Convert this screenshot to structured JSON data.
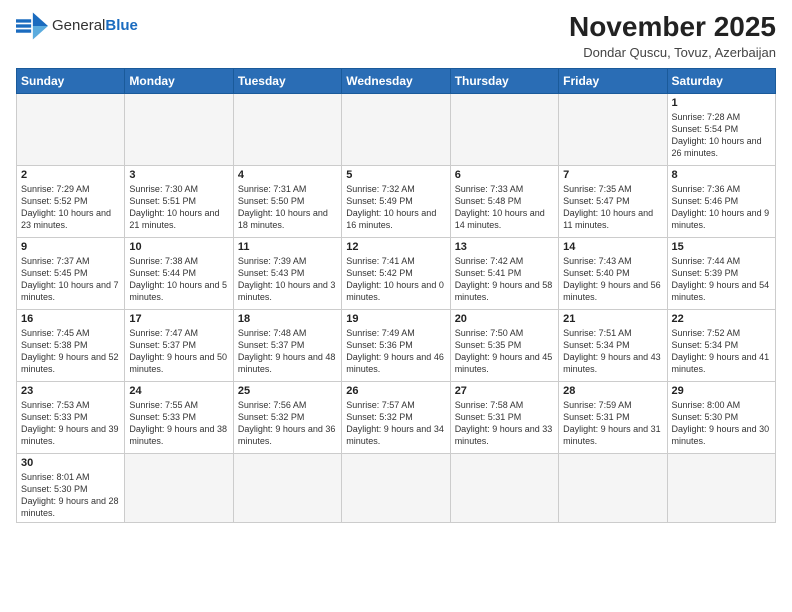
{
  "header": {
    "logo_general": "General",
    "logo_blue": "Blue",
    "month_year": "November 2025",
    "location": "Dondar Quscu, Tovuz, Azerbaijan"
  },
  "weekdays": [
    "Sunday",
    "Monday",
    "Tuesday",
    "Wednesday",
    "Thursday",
    "Friday",
    "Saturday"
  ],
  "weeks": [
    [
      {
        "day": "",
        "info": ""
      },
      {
        "day": "",
        "info": ""
      },
      {
        "day": "",
        "info": ""
      },
      {
        "day": "",
        "info": ""
      },
      {
        "day": "",
        "info": ""
      },
      {
        "day": "",
        "info": ""
      },
      {
        "day": "1",
        "info": "Sunrise: 7:28 AM\nSunset: 5:54 PM\nDaylight: 10 hours and 26 minutes."
      }
    ],
    [
      {
        "day": "2",
        "info": "Sunrise: 7:29 AM\nSunset: 5:52 PM\nDaylight: 10 hours and 23 minutes."
      },
      {
        "day": "3",
        "info": "Sunrise: 7:30 AM\nSunset: 5:51 PM\nDaylight: 10 hours and 21 minutes."
      },
      {
        "day": "4",
        "info": "Sunrise: 7:31 AM\nSunset: 5:50 PM\nDaylight: 10 hours and 18 minutes."
      },
      {
        "day": "5",
        "info": "Sunrise: 7:32 AM\nSunset: 5:49 PM\nDaylight: 10 hours and 16 minutes."
      },
      {
        "day": "6",
        "info": "Sunrise: 7:33 AM\nSunset: 5:48 PM\nDaylight: 10 hours and 14 minutes."
      },
      {
        "day": "7",
        "info": "Sunrise: 7:35 AM\nSunset: 5:47 PM\nDaylight: 10 hours and 11 minutes."
      },
      {
        "day": "8",
        "info": "Sunrise: 7:36 AM\nSunset: 5:46 PM\nDaylight: 10 hours and 9 minutes."
      }
    ],
    [
      {
        "day": "9",
        "info": "Sunrise: 7:37 AM\nSunset: 5:45 PM\nDaylight: 10 hours and 7 minutes."
      },
      {
        "day": "10",
        "info": "Sunrise: 7:38 AM\nSunset: 5:44 PM\nDaylight: 10 hours and 5 minutes."
      },
      {
        "day": "11",
        "info": "Sunrise: 7:39 AM\nSunset: 5:43 PM\nDaylight: 10 hours and 3 minutes."
      },
      {
        "day": "12",
        "info": "Sunrise: 7:41 AM\nSunset: 5:42 PM\nDaylight: 10 hours and 0 minutes."
      },
      {
        "day": "13",
        "info": "Sunrise: 7:42 AM\nSunset: 5:41 PM\nDaylight: 9 hours and 58 minutes."
      },
      {
        "day": "14",
        "info": "Sunrise: 7:43 AM\nSunset: 5:40 PM\nDaylight: 9 hours and 56 minutes."
      },
      {
        "day": "15",
        "info": "Sunrise: 7:44 AM\nSunset: 5:39 PM\nDaylight: 9 hours and 54 minutes."
      }
    ],
    [
      {
        "day": "16",
        "info": "Sunrise: 7:45 AM\nSunset: 5:38 PM\nDaylight: 9 hours and 52 minutes."
      },
      {
        "day": "17",
        "info": "Sunrise: 7:47 AM\nSunset: 5:37 PM\nDaylight: 9 hours and 50 minutes."
      },
      {
        "day": "18",
        "info": "Sunrise: 7:48 AM\nSunset: 5:37 PM\nDaylight: 9 hours and 48 minutes."
      },
      {
        "day": "19",
        "info": "Sunrise: 7:49 AM\nSunset: 5:36 PM\nDaylight: 9 hours and 46 minutes."
      },
      {
        "day": "20",
        "info": "Sunrise: 7:50 AM\nSunset: 5:35 PM\nDaylight: 9 hours and 45 minutes."
      },
      {
        "day": "21",
        "info": "Sunrise: 7:51 AM\nSunset: 5:34 PM\nDaylight: 9 hours and 43 minutes."
      },
      {
        "day": "22",
        "info": "Sunrise: 7:52 AM\nSunset: 5:34 PM\nDaylight: 9 hours and 41 minutes."
      }
    ],
    [
      {
        "day": "23",
        "info": "Sunrise: 7:53 AM\nSunset: 5:33 PM\nDaylight: 9 hours and 39 minutes."
      },
      {
        "day": "24",
        "info": "Sunrise: 7:55 AM\nSunset: 5:33 PM\nDaylight: 9 hours and 38 minutes."
      },
      {
        "day": "25",
        "info": "Sunrise: 7:56 AM\nSunset: 5:32 PM\nDaylight: 9 hours and 36 minutes."
      },
      {
        "day": "26",
        "info": "Sunrise: 7:57 AM\nSunset: 5:32 PM\nDaylight: 9 hours and 34 minutes."
      },
      {
        "day": "27",
        "info": "Sunrise: 7:58 AM\nSunset: 5:31 PM\nDaylight: 9 hours and 33 minutes."
      },
      {
        "day": "28",
        "info": "Sunrise: 7:59 AM\nSunset: 5:31 PM\nDaylight: 9 hours and 31 minutes."
      },
      {
        "day": "29",
        "info": "Sunrise: 8:00 AM\nSunset: 5:30 PM\nDaylight: 9 hours and 30 minutes."
      }
    ],
    [
      {
        "day": "30",
        "info": "Sunrise: 8:01 AM\nSunset: 5:30 PM\nDaylight: 9 hours and 28 minutes."
      },
      {
        "day": "",
        "info": ""
      },
      {
        "day": "",
        "info": ""
      },
      {
        "day": "",
        "info": ""
      },
      {
        "day": "",
        "info": ""
      },
      {
        "day": "",
        "info": ""
      },
      {
        "day": "",
        "info": ""
      }
    ]
  ]
}
